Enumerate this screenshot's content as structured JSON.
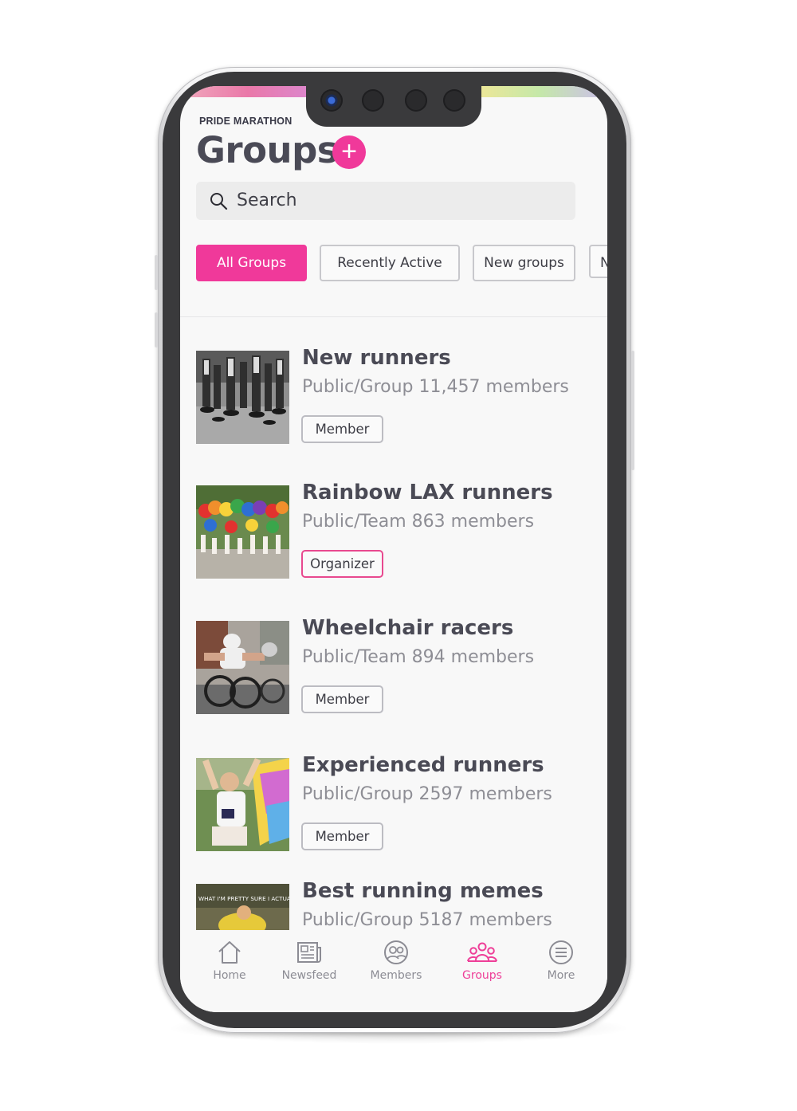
{
  "app": {
    "brand": "PRIDE MARATHON"
  },
  "header": {
    "title": "Groups",
    "add_label": "+"
  },
  "search": {
    "placeholder": "Search"
  },
  "filters": [
    {
      "label": "All Groups",
      "active": true
    },
    {
      "label": "Recently Active",
      "active": false
    },
    {
      "label": "New groups",
      "active": false
    },
    {
      "label": "N",
      "active": false
    }
  ],
  "groups": [
    {
      "name": "New runners",
      "meta": "Public/Group 11,457 members",
      "role": "Member",
      "thumb": "running-legs-photo"
    },
    {
      "name": "Rainbow LAX runners",
      "meta": "Public/Team 863 members",
      "role": "Organizer",
      "thumb": "pride-parade-photo"
    },
    {
      "name": "Wheelchair racers",
      "meta": "Public/Team 894 members",
      "role": "Member",
      "thumb": "wheelchair-racer-photo"
    },
    {
      "name": "Experienced runners",
      "meta": "Public/Group 2597 members",
      "role": "Member",
      "thumb": "runner-flag-photo"
    },
    {
      "name": "Best running memes",
      "meta": "Public/Group 5187 members",
      "role": "",
      "thumb": "meme-photo",
      "thumb_caption": "WHAT I'M PRETTY SURE I ACTUALLY LOOK LIKE"
    }
  ],
  "tabs": [
    {
      "label": "Home",
      "icon": "home-icon",
      "active": false
    },
    {
      "label": "Newsfeed",
      "icon": "newsfeed-icon",
      "active": false
    },
    {
      "label": "Members",
      "icon": "members-icon",
      "active": false
    },
    {
      "label": "Groups",
      "icon": "groups-icon",
      "active": true
    },
    {
      "label": "More",
      "icon": "more-icon",
      "active": false
    }
  ],
  "colors": {
    "accent": "#f0399a",
    "text": "#4a4a55",
    "muted": "#8e8e95",
    "tab_inactive": "#8c8c94"
  }
}
